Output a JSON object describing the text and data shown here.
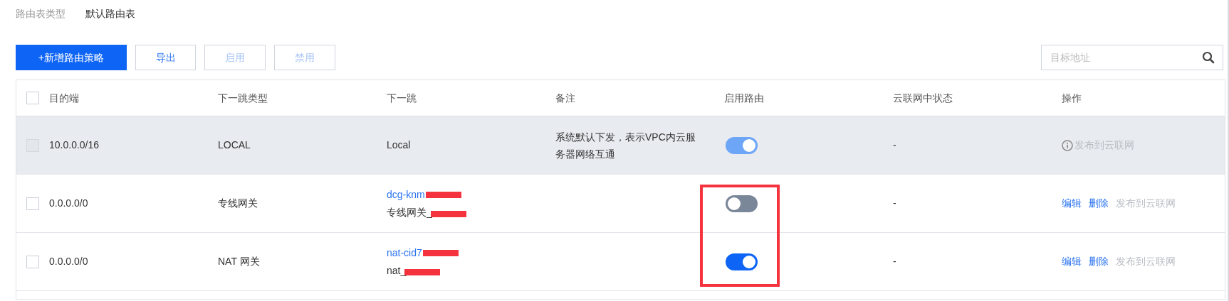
{
  "breadcrumb": [
    {
      "label": "路由表类型",
      "selected": false
    },
    {
      "label": "默认路由表",
      "selected": true
    }
  ],
  "toolbar": {
    "buttons": [
      {
        "label": "+新增路由策略",
        "kind": "primary"
      },
      {
        "label": "导出",
        "kind": "default"
      },
      {
        "label": "启用",
        "kind": "disabled"
      },
      {
        "label": "禁用",
        "kind": "disabled"
      }
    ],
    "search": {
      "placeholder": "目标地址"
    }
  },
  "table": {
    "select_all": {
      "checked": false
    },
    "columns": [
      "目的端",
      "下一跳类型",
      "下一跳",
      "备注",
      "启用路由",
      "云联网中状态",
      "操作"
    ],
    "rows": [
      {
        "checkbox": {
          "checked": false,
          "disabled": true
        },
        "destination": "10.0.0.0/16",
        "next_hop_type": "LOCAL",
        "next_hop": {
          "name": "Local",
          "redacted": false
        },
        "remark": "系统默认下发，表示VPC内云服务器网络互通",
        "route": {
          "on": true,
          "disabled": true
        },
        "status": "-",
        "shaded": true,
        "framed": false,
        "actions": [
          {
            "label": "发布到云联网",
            "kind": "info-disabled"
          }
        ]
      },
      {
        "checkbox": {
          "checked": false,
          "disabled": false
        },
        "destination": "0.0.0.0/0",
        "next_hop_type": "专线网关",
        "next_hop": {
          "id": "dcg-knm",
          "name": "专线网关_",
          "redacted": true
        },
        "route": {
          "on": false,
          "disabled": false
        },
        "status": "-",
        "shaded": false,
        "framed": true,
        "actions": [
          {
            "label": "编辑",
            "kind": "link"
          },
          {
            "label": "删除",
            "kind": "link"
          },
          {
            "label": "发布到云联网",
            "kind": "disabled"
          }
        ]
      },
      {
        "checkbox": {
          "checked": false,
          "disabled": false
        },
        "destination": "0.0.0.0/0",
        "next_hop_type": "NAT 网关",
        "next_hop": {
          "id": "nat-cid7",
          "name": "nat_",
          "redacted": true
        },
        "route": {
          "on": true,
          "disabled": false
        },
        "status": "-",
        "shaded": false,
        "framed": true,
        "actions": [
          {
            "label": "编辑",
            "kind": "link"
          },
          {
            "label": "删除",
            "kind": "link"
          },
          {
            "label": "发布到云联网",
            "kind": "disabled"
          }
        ]
      }
    ]
  }
}
